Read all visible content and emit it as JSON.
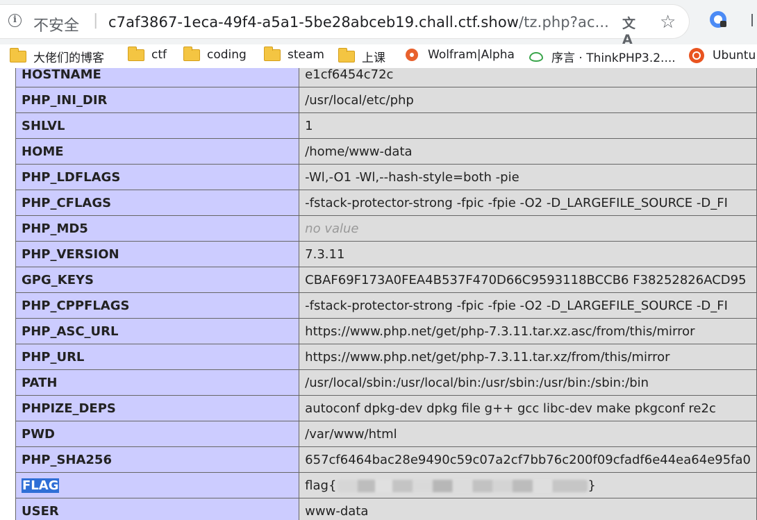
{
  "browser": {
    "security_label": "不安全",
    "separator": "|",
    "url_host": "c7af3867-1eca-49f4-a5a1-5be28abceb19.chall.ctf.show",
    "url_rest": "/tz.php?ac..."
  },
  "bookmarks": [
    {
      "label": "大佬们的博客",
      "icon": "folder-icon"
    },
    {
      "label": "ctf",
      "icon": "folder-icon"
    },
    {
      "label": "coding",
      "icon": "folder-icon"
    },
    {
      "label": "steam",
      "icon": "folder-icon"
    },
    {
      "label": "上课",
      "icon": "folder-icon"
    },
    {
      "label": "Wolfram|Alpha",
      "icon": "wolfram-icon"
    },
    {
      "label": "序言 · ThinkPHP3.2....",
      "icon": "thinkphp-icon"
    },
    {
      "label": "Ubuntu",
      "icon": "ubuntu-icon"
    }
  ],
  "env": [
    {
      "key": "HOSTNAME",
      "value": "e1cf6454c72c"
    },
    {
      "key": "PHP_INI_DIR",
      "value": "/usr/local/etc/php"
    },
    {
      "key": "SHLVL",
      "value": "1"
    },
    {
      "key": "HOME",
      "value": "/home/www-data"
    },
    {
      "key": "PHP_LDFLAGS",
      "value": "-Wl,-O1 -Wl,--hash-style=both -pie"
    },
    {
      "key": "PHP_CFLAGS",
      "value": "-fstack-protector-strong -fpic -fpie -O2 -D_LARGEFILE_SOURCE -D_FI"
    },
    {
      "key": "PHP_MD5",
      "value": "no value"
    },
    {
      "key": "PHP_VERSION",
      "value": "7.3.11"
    },
    {
      "key": "GPG_KEYS",
      "value": "CBAF69F173A0FEA4B537F470D66C9593118BCCB6 F38252826ACD95"
    },
    {
      "key": "PHP_CPPFLAGS",
      "value": "-fstack-protector-strong -fpic -fpie -O2 -D_LARGEFILE_SOURCE -D_FI"
    },
    {
      "key": "PHP_ASC_URL",
      "value": "https://www.php.net/get/php-7.3.11.tar.xz.asc/from/this/mirror"
    },
    {
      "key": "PHP_URL",
      "value": "https://www.php.net/get/php-7.3.11.tar.xz/from/this/mirror"
    },
    {
      "key": "PATH",
      "value": "/usr/local/sbin:/usr/local/bin:/usr/sbin:/usr/bin:/sbin:/bin"
    },
    {
      "key": "PHPIZE_DEPS",
      "value": "autoconf dpkg-dev dpkg file g++ gcc libc-dev make pkgconf re2c"
    },
    {
      "key": "PWD",
      "value": "/var/www/html"
    },
    {
      "key": "PHP_SHA256",
      "value": "657cf6464bac28e9490c59c07a2cf7bb76c200f09cfadf6e44ea64e95fa0"
    },
    {
      "key": "FLAG",
      "value_prefix": "flag{",
      "value_suffix": "}"
    },
    {
      "key": "USER",
      "value": "www-data"
    }
  ]
}
